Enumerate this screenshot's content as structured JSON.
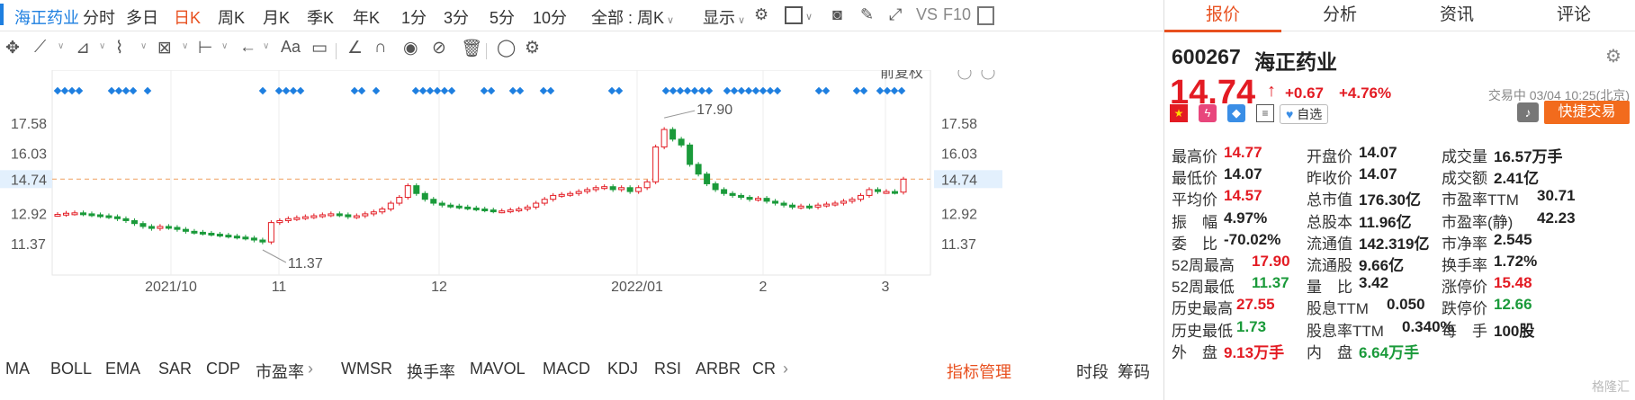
{
  "periods": {
    "stock_name": "海正药业",
    "items": [
      "分时",
      "多日",
      "日K",
      "周K",
      "月K",
      "季K",
      "年K",
      "1分",
      "3分",
      "5分",
      "10分"
    ],
    "active_index": 2,
    "range_label": "全部 : 周K",
    "display_label": "显示",
    "vs_label": "VS",
    "f10_label": "F10"
  },
  "draw_tools": {
    "aa_label": "Aa"
  },
  "chart": {
    "fuquan_label": "前复权",
    "x_tick_labels": [
      "2021/10",
      "11",
      "12",
      "2022/01",
      "2",
      "3"
    ],
    "y_tick_labels": [
      "17.58",
      "16.03",
      "12.92",
      "11.37"
    ],
    "current_price_label": "14.74",
    "high_annotation": "17.90",
    "low_annotation": "11.37"
  },
  "chart_data": {
    "type": "candlestick",
    "y_ticks": [
      11.37,
      12.92,
      14.74,
      16.03,
      17.58
    ],
    "current_price": 14.74,
    "high_marker": 17.9,
    "low_marker": 11.37,
    "colors": {
      "up": "#e31b23",
      "down": "#1a9a3a",
      "marker": "#1e7fe0",
      "price_line": "#f0a060"
    }
  },
  "indicators": {
    "items": [
      "MA",
      "BOLL",
      "EMA",
      "SAR",
      "CDP",
      "市盈率",
      "WMSR",
      "换手率",
      "MAVOL",
      "MACD",
      "KDJ",
      "RSI",
      "ARBR",
      "CR"
    ],
    "manage_label": "指标管理",
    "fenshi_label": "时段",
    "chouma_label": "筹码"
  },
  "quote": {
    "tabs": [
      "报价",
      "分析",
      "资讯",
      "评论"
    ],
    "code": "600267",
    "name": "海正药业",
    "price": "14.74",
    "change": "+0.67",
    "change_pct": "+4.76%",
    "status": "交易中 03/04 10:25(北京)",
    "watch_label": "自选",
    "trade_label": "快捷交易",
    "rows": [
      [
        {
          "l": "最高价",
          "v": "14.77",
          "c": "red"
        },
        {
          "l": "开盘价",
          "v": "14.07",
          "c": "blk"
        },
        {
          "l": "成交量",
          "v": "16.57万手",
          "c": "blk"
        }
      ],
      [
        {
          "l": "最低价",
          "v": "14.07",
          "c": "blk"
        },
        {
          "l": "昨收价",
          "v": "14.07",
          "c": "blk"
        },
        {
          "l": "成交额",
          "v": "2.41亿",
          "c": "blk"
        }
      ],
      [
        {
          "l": "平均价",
          "v": "14.57",
          "c": "red"
        },
        {
          "l": "总市值",
          "v": "176.30亿",
          "c": "blk"
        },
        {
          "l": "市盈率TTM",
          "v": "30.71",
          "c": "blk"
        }
      ],
      [
        {
          "l": "振　幅",
          "v": "4.97%",
          "c": "blk"
        },
        {
          "l": "总股本",
          "v": "11.96亿",
          "c": "blk"
        },
        {
          "l": "市盈率(静)",
          "v": "42.23",
          "c": "blk"
        }
      ],
      [
        {
          "l": "委　比",
          "v": "-70.02%",
          "c": "blk"
        },
        {
          "l": "流通值",
          "v": "142.319亿",
          "c": "blk"
        },
        {
          "l": "市净率",
          "v": "2.545",
          "c": "blk"
        }
      ],
      [
        {
          "l": "52周最高",
          "v": "17.90",
          "c": "red"
        },
        {
          "l": "流通股",
          "v": "9.66亿",
          "c": "blk"
        },
        {
          "l": "换手率",
          "v": "1.72%",
          "c": "blk"
        }
      ],
      [
        {
          "l": "52周最低",
          "v": "11.37",
          "c": "green"
        },
        {
          "l": "量　比",
          "v": "3.42",
          "c": "blk"
        },
        {
          "l": "涨停价",
          "v": "15.48",
          "c": "red"
        }
      ],
      [
        {
          "l": "历史最高",
          "v": "27.55",
          "c": "red"
        },
        {
          "l": "股息TTM",
          "v": "0.050",
          "c": "blk"
        },
        {
          "l": "跌停价",
          "v": "12.66",
          "c": "green"
        }
      ],
      [
        {
          "l": "历史最低",
          "v": "1.73",
          "c": "green"
        },
        {
          "l": "股息率TTM",
          "v": "0.340%",
          "c": "blk"
        },
        {
          "l": "每　手",
          "v": "100股",
          "c": "blk"
        }
      ],
      [
        {
          "l": "外　盘",
          "v": "9.13万手",
          "c": "red"
        },
        {
          "l": "内　盘",
          "v": "6.64万手",
          "c": "green"
        },
        {
          "l": "",
          "v": "",
          "c": "blk"
        }
      ]
    ],
    "watermark": "格隆汇"
  }
}
